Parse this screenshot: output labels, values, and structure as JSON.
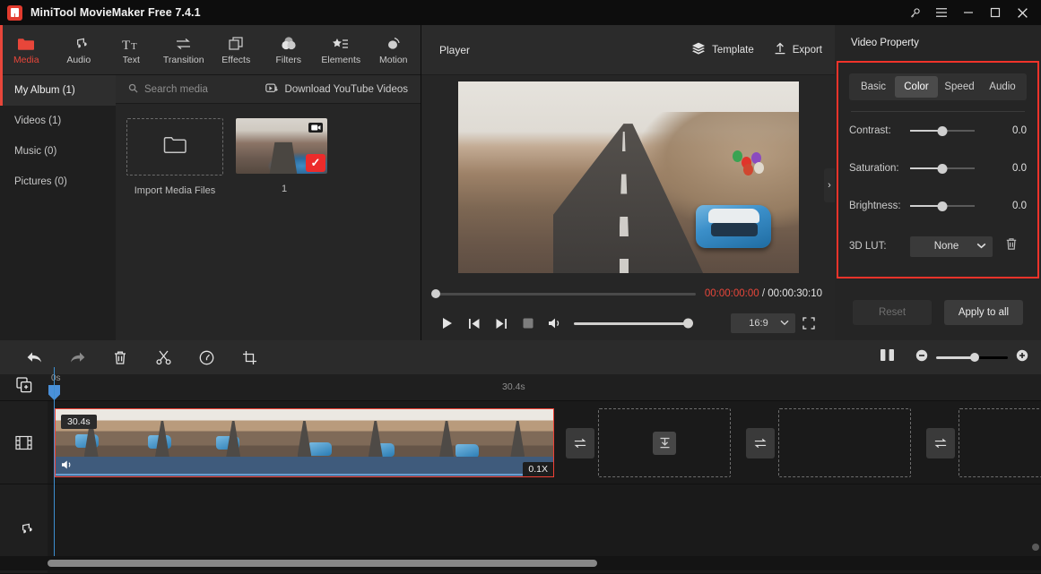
{
  "titlebar": {
    "app_title": "MiniTool MovieMaker Free 7.4.1",
    "buttons": [
      {
        "name": "key-icon",
        "label": "Register"
      },
      {
        "name": "menu-icon",
        "label": "Menu"
      },
      {
        "name": "minimize-icon",
        "label": "Minimize"
      },
      {
        "name": "maximize-icon",
        "label": "Maximize"
      },
      {
        "name": "close-icon",
        "label": "Close"
      }
    ]
  },
  "tabs": [
    {
      "label": "Media",
      "icon": "folder-icon",
      "active": true
    },
    {
      "label": "Audio",
      "icon": "music-note-icon",
      "active": false
    },
    {
      "label": "Text",
      "icon": "text-icon",
      "active": false
    },
    {
      "label": "Transition",
      "icon": "transition-arrows-icon",
      "active": false
    },
    {
      "label": "Effects",
      "icon": "effects-squares-icon",
      "active": false
    },
    {
      "label": "Filters",
      "icon": "filters-circles-icon",
      "active": false
    },
    {
      "label": "Elements",
      "icon": "elements-star-list-icon",
      "active": false
    },
    {
      "label": "Motion",
      "icon": "motion-icon",
      "active": false
    }
  ],
  "media": {
    "albums": [
      {
        "label": "My Album (1)",
        "selected": true
      },
      {
        "label": "Videos (1)",
        "selected": false
      },
      {
        "label": "Music (0)",
        "selected": false
      },
      {
        "label": "Pictures (0)",
        "selected": false
      }
    ],
    "search_placeholder": "Search media",
    "download_youtube": "Download YouTube Videos",
    "import_label": "Import Media Files",
    "item_label": "1"
  },
  "player": {
    "title": "Player",
    "template_label": "Template",
    "export_label": "Export",
    "current_time": "00:00:00:00",
    "separator": "/",
    "total_time": "00:00:30:10",
    "aspect_ratio": "16:9",
    "controls": [
      {
        "name": "play-button",
        "label": "Play"
      },
      {
        "name": "previous-frame-button",
        "label": "Previous frame"
      },
      {
        "name": "next-frame-button",
        "label": "Next frame"
      },
      {
        "name": "stop-button",
        "label": "Stop"
      },
      {
        "name": "volume-button",
        "label": "Volume"
      }
    ]
  },
  "property": {
    "panel_title": "Video Property",
    "tabs": [
      {
        "label": "Basic",
        "active": false
      },
      {
        "label": "Color",
        "active": true
      },
      {
        "label": "Speed",
        "active": false
      },
      {
        "label": "Audio",
        "active": false
      }
    ],
    "controls": [
      {
        "label": "Contrast:",
        "value": "0.0"
      },
      {
        "label": "Saturation:",
        "value": "0.0"
      },
      {
        "label": "Brightness:",
        "value": "0.0"
      }
    ],
    "lut_label": "3D LUT:",
    "lut_value": "None",
    "reset_label": "Reset",
    "apply_all_label": "Apply to all",
    "highlight_color": "#f1332a"
  },
  "timeline": {
    "toolbar": [
      {
        "name": "undo-button",
        "label": "Undo"
      },
      {
        "name": "redo-button",
        "label": "Redo"
      },
      {
        "name": "delete-button",
        "label": "Delete"
      },
      {
        "name": "split-button",
        "label": "Split"
      },
      {
        "name": "speed-button",
        "label": "Speed"
      },
      {
        "name": "crop-button",
        "label": "Crop"
      }
    ],
    "ruler_start": "0s",
    "ruler_mark": "30.4s",
    "clip_duration": "30.4s",
    "clip_speed": "0.1X",
    "tracks": [
      {
        "name": "video-track",
        "icon": "film-strip-icon"
      },
      {
        "name": "audio-track",
        "icon": "music-note-icon"
      }
    ],
    "add-media-icon": "add-media-icon",
    "split-view-icon": "split-view-icon",
    "zoom_out": "−",
    "zoom_in": "+"
  }
}
